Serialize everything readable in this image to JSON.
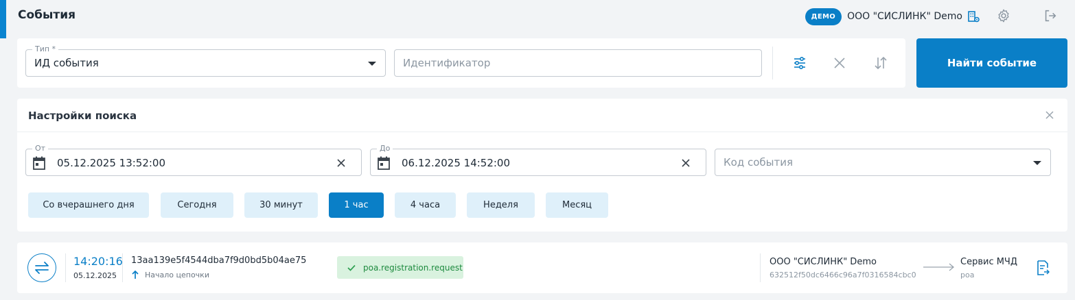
{
  "header": {
    "title": "События",
    "demo_badge": "ДЕМО",
    "org_name": "ООО \"СИСЛИНК\" Demo"
  },
  "search": {
    "type_label": "Тип *",
    "type_value": "ИД события",
    "identifier_placeholder": "Идентификатор",
    "find_button": "Найти событие"
  },
  "settings": {
    "title": "Настройки поиска",
    "from_label": "От",
    "from_value": "05.12.2025 13:52:00",
    "to_label": "До",
    "to_value": "06.12.2025 14:52:00",
    "event_code_placeholder": "Код события",
    "quick_ranges": [
      {
        "label": "Со вчерашнего дня",
        "active": false
      },
      {
        "label": "Сегодня",
        "active": false
      },
      {
        "label": "30 минут",
        "active": false
      },
      {
        "label": "1 час",
        "active": true
      },
      {
        "label": "4 часа",
        "active": false
      },
      {
        "label": "Неделя",
        "active": false
      },
      {
        "label": "Месяц",
        "active": false
      }
    ]
  },
  "events": [
    {
      "time": "14:20:16",
      "date": "05.12.2025",
      "id": "13aa139e5f4544dba7f9d0bd5b04ae75",
      "chain": "Начало цепочки",
      "type": "poa.registration.request",
      "from_name": "ООО \"СИСЛИНК\" Demo",
      "from_id": "632512f50dc6466c96a7f0316584cbc0",
      "to_name": "Сервис МЧД",
      "to_sub": "poa"
    }
  ],
  "colors": {
    "accent": "#0a7fc7",
    "success_bg": "#d9f2df",
    "success_text": "#1d8a3e"
  }
}
